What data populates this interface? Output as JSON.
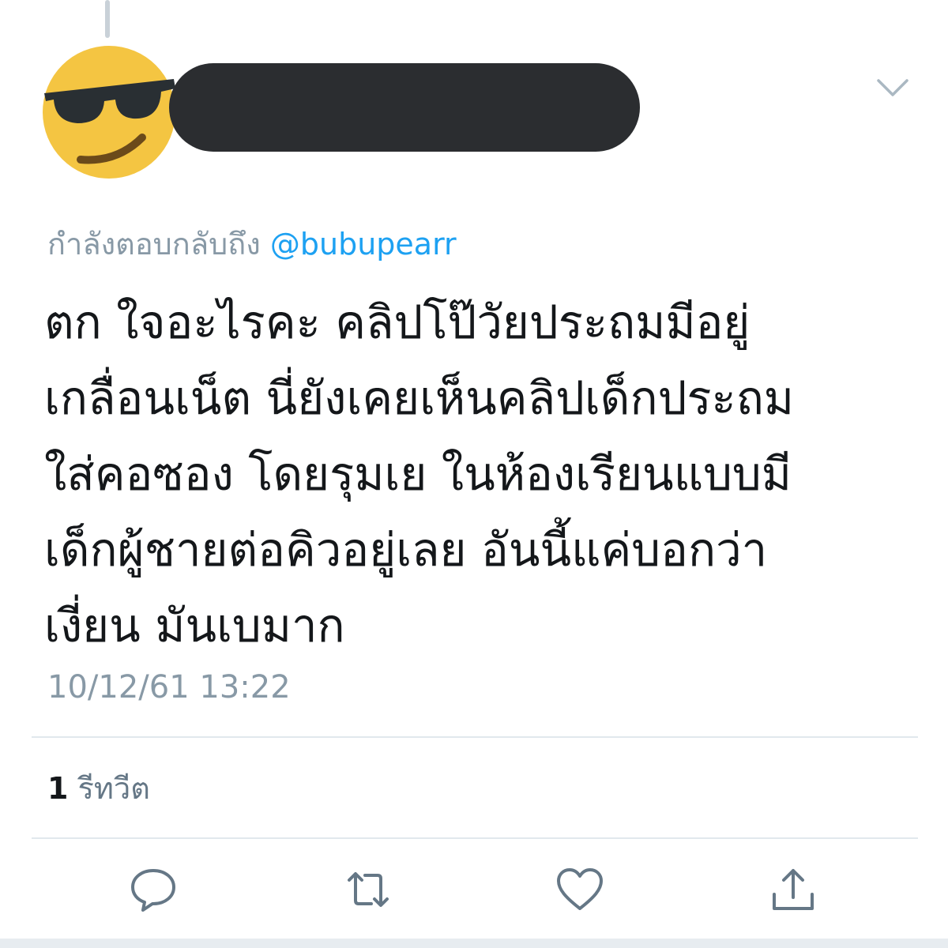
{
  "tweet": {
    "avatar_icon": "sunglasses-emoji-icon",
    "more_icon": "chevron-down-icon",
    "reply_prefix": "กำลังตอบกลับถึง",
    "reply_handle": "@bubupearr",
    "text": "ตก ใจอะไรคะ คลิปโป๊วัยประถมมีอยู่\nเกลื่อนเน็ต นี่ยังเคยเห็นคลิปเด็กประถม\n ใส่คอซอง โดยรุมเย ในห้องเรียนแบบมี\nเด็กผู้ชายต่อคิวอยู่เลย อันนี้แค่บอกว่า\nเงี่ยน มันเบมาก",
    "timestamp": "10/12/61 13:22"
  },
  "stats": {
    "retweet_count": "1",
    "retweet_label": "รีทวีต"
  },
  "actions": [
    {
      "icon": "reply-icon"
    },
    {
      "icon": "retweet-icon"
    },
    {
      "icon": "like-icon"
    },
    {
      "icon": "share-icon"
    }
  ],
  "colors": {
    "accent": "#1da1f2",
    "muted": "#8899a6",
    "text": "#14171a",
    "redaction": "#2b2d30"
  }
}
